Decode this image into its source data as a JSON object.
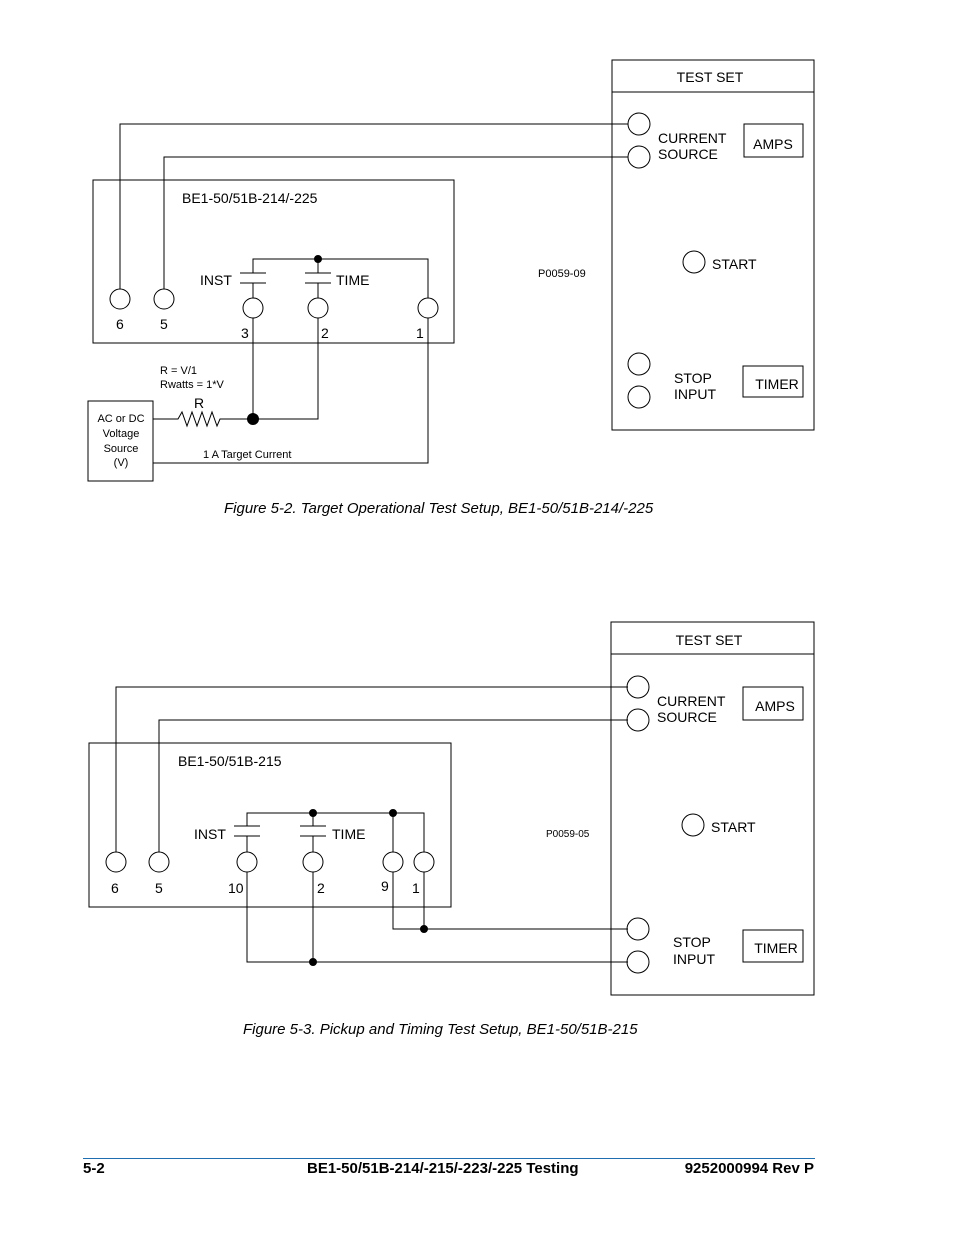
{
  "figure1": {
    "relay_label": "BE1-50/51B-214/-225",
    "terminals": [
      "6",
      "5",
      "3",
      "2",
      "1"
    ],
    "contact_inst": "INST",
    "contact_time": "TIME",
    "formula_r": "R = V/1",
    "formula_watts": "Rwatts = 1*V",
    "resistor_label": "R",
    "source_lines": [
      "AC or DC",
      "Voltage",
      "Source",
      "(V)"
    ],
    "target_current": "1 A Target Current",
    "drawing_id": "P0059-09",
    "test_set": {
      "title": "TEST SET",
      "current_source": [
        "CURRENT",
        "SOURCE"
      ],
      "amps": "AMPS",
      "start": "START",
      "stop_input": [
        "STOP",
        "INPUT"
      ],
      "timer": "TIMER"
    },
    "caption": "Figure 5-2. Target Operational Test Setup, BE1-50/51B-214/-225"
  },
  "figure2": {
    "relay_label": "BE1-50/51B-215",
    "terminals": [
      "6",
      "5",
      "10",
      "2",
      "9",
      "1"
    ],
    "contact_inst": "INST",
    "contact_time": "TIME",
    "drawing_id": "P0059-05",
    "test_set": {
      "title": "TEST SET",
      "current_source": [
        "CURRENT",
        "SOURCE"
      ],
      "amps": "AMPS",
      "start": "START",
      "stop_input": [
        "STOP",
        "INPUT"
      ],
      "timer": "TIMER"
    },
    "caption": "Figure 5-3. Pickup and Timing Test Setup, BE1-50/51B-215"
  },
  "footer": {
    "page": "5-2",
    "title": "BE1-50/51B-214/-215/-223/-225 Testing",
    "doc_number": "9252000994 Rev P",
    "rule_color": "#1f6fb0"
  }
}
